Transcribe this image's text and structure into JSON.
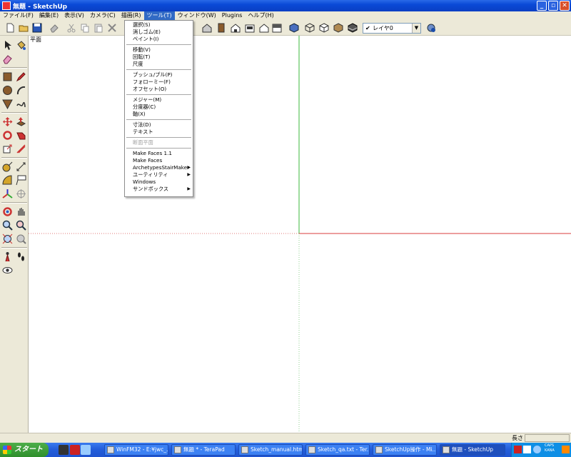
{
  "window": {
    "title": "無題 - SketchUp"
  },
  "menubar": [
    "ファイル(F)",
    "編集(E)",
    "表示(V)",
    "カメラ(C)",
    "描画(R)",
    "ツール(T)",
    "ウィンドウ(W)",
    "Plugins",
    "ヘルプ(H)"
  ],
  "toolbar": {
    "layer_name": "レイヤ0"
  },
  "canvas": {
    "view_label": "平面"
  },
  "tools_menu": {
    "items": [
      {
        "label": "選択(S)"
      },
      {
        "label": "消しゴム(E)"
      },
      {
        "label": "ペイント(I)"
      },
      {
        "label": "移動(V)"
      },
      {
        "label": "回転(T)"
      },
      {
        "label": "尺度"
      },
      {
        "label": "プッシュ/プル(P)"
      },
      {
        "label": "フォローミー(F)"
      },
      {
        "label": "オフセット(O)"
      },
      {
        "label": "メジャー(M)"
      },
      {
        "label": "分度器(C)"
      },
      {
        "label": "軸(X)"
      },
      {
        "label": "寸法(D)"
      },
      {
        "label": "テキスト"
      },
      {
        "label": "断面平面"
      },
      {
        "label": "Make Faces 1.1"
      },
      {
        "label": "Make Faces"
      },
      {
        "label": "ArchetypesStairMaker"
      },
      {
        "label": "ユーティリティ"
      },
      {
        "label": "Windows"
      },
      {
        "label": "サンドボックス"
      }
    ]
  },
  "statusbar": {
    "measure_label": "長さ"
  },
  "taskbar": {
    "start_label": "スタート",
    "tasks": [
      "WinFM32 - E:¥jwc_...",
      "無題 * - TeraPad",
      "Sketch_manual.htm ...",
      "Sketch_qa.txt - Ter...",
      "SketchUp操作 - Mi...",
      "無題 - SketchUp"
    ],
    "tray_text_1": "CAPS",
    "tray_text_2": "KANA"
  },
  "colors": {
    "axis_green": "#3cb83c",
    "axis_red": "#d83c3c",
    "menu_highlight": "#316ac5",
    "xp_blue": "#245edb",
    "chrome": "#ece9d8"
  }
}
